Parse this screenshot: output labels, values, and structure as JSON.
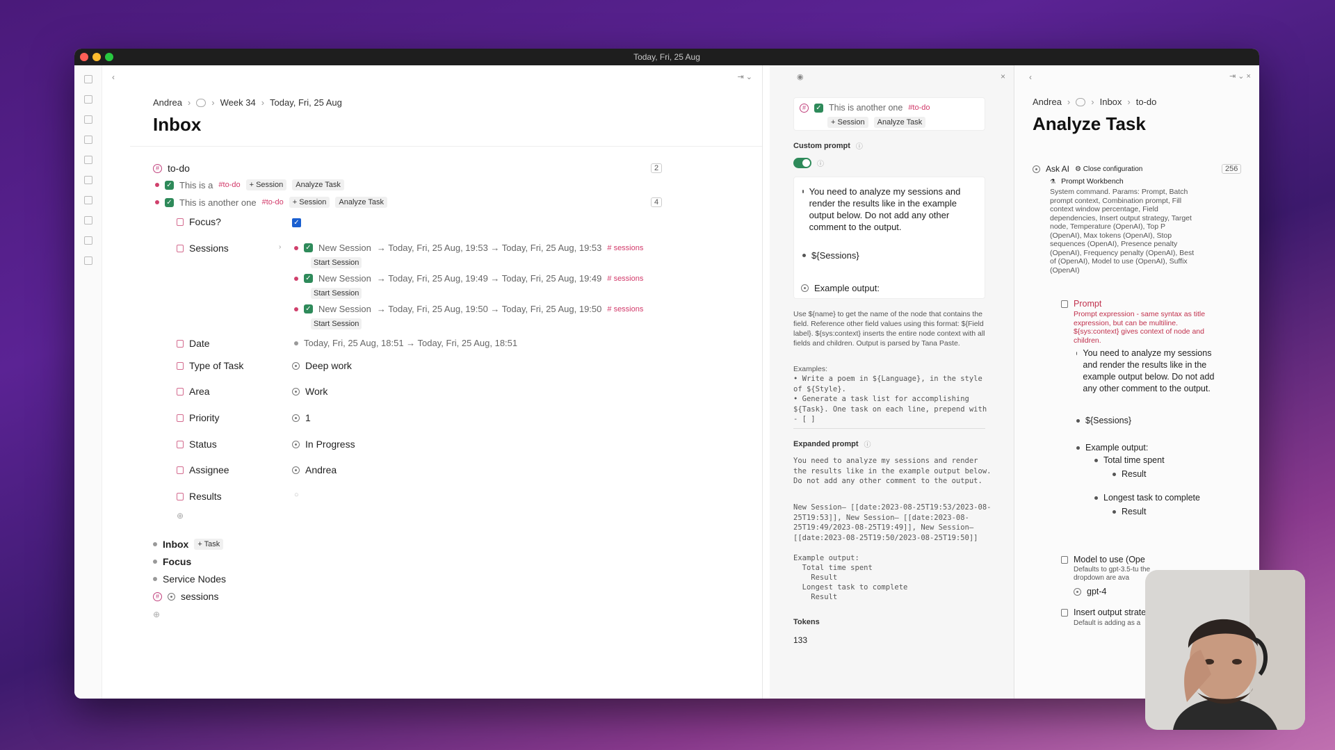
{
  "window": {
    "title": "Today, Fri, 25 Aug"
  },
  "left": {
    "breadcrumb": [
      "Andrea",
      "Week 34",
      "Today, Fri, 25 Aug"
    ],
    "title": "Inbox",
    "todo": {
      "label": "to-do",
      "count": "2"
    },
    "task1": {
      "prefix": "This is a",
      "tag": "#to-do",
      "session_btn": "+ Session",
      "analyze_btn": "Analyze Task"
    },
    "task2": {
      "label": "This is another one",
      "tag": "#to-do",
      "session_btn": "+ Session",
      "analyze_btn": "Analyze Task",
      "count": "4"
    },
    "fields": {
      "focus": "Focus?",
      "sessions": "Sessions",
      "date": "Date",
      "date_value": "Today, Fri, 25 Aug, 18:51 → Today, Fri, 25 Aug, 18:51",
      "type": "Type of Task",
      "type_value": "Deep work",
      "area": "Area",
      "area_value": "Work",
      "priority": "Priority",
      "priority_value": "1",
      "status": "Status",
      "status_value": "In Progress",
      "assignee": "Assignee",
      "assignee_value": "Andrea",
      "results": "Results"
    },
    "sessions": [
      {
        "name": "New Session",
        "range": "→ Today, Fri, 25 Aug, 19:53 → Today, Fri, 25 Aug, 19:53",
        "tag": "# sessions",
        "btn": "Start Session"
      },
      {
        "name": "New Session",
        "range": "→ Today, Fri, 25 Aug, 19:49 → Today, Fri, 25 Aug, 19:49",
        "tag": "# sessions",
        "btn": "Start Session"
      },
      {
        "name": "New Session",
        "range": "→ Today, Fri, 25 Aug, 19:50 → Today, Fri, 25 Aug, 19:50",
        "tag": "# sessions",
        "btn": "Start Session"
      }
    ],
    "bottom": {
      "inbox": "Inbox",
      "task_btn": "+ Task",
      "focus": "Focus",
      "service": "Service Nodes",
      "sessions": "sessions"
    }
  },
  "middle": {
    "node": {
      "label": "This is another one",
      "tag": "#to-do",
      "session_btn": "+ Session",
      "analyze_btn": "Analyze Task"
    },
    "custom_prompt": "Custom prompt",
    "prompt_items": [
      "You need to analyze my sessions and render the results like in the example output below. Do not add any other comment to the output.",
      "${Sessions}",
      "Example output:"
    ],
    "help": "Use ${name} to get the name of the node that contains the field. Reference other field values using this format: ${Field label}. ${sys:context} inserts the entire node context with all fields and children. Output is parsed by Tana Paste.",
    "examples_label": "Examples:",
    "examples": [
      "• Write a poem in ${Language}, in the style of ${Style}.",
      "• Generate a task list for accomplishing ${Task}. One task on each line, prepend with - [ ]"
    ],
    "expanded_label": "Expanded prompt",
    "expanded_1": "You need to analyze my sessions and render the results like in the example output below. Do not add any other comment to the output.",
    "expanded_2": "New Session– [[date:2023-08-25T19:53/2023-08-25T19:53]], New Session– [[date:2023-08-25T19:49/2023-08-25T19:49]], New Session– [[date:2023-08-25T19:50/2023-08-25T19:50]]",
    "expanded_3": [
      "Example output:",
      "  Total time spent",
      "    Result",
      "  Longest task to complete",
      "    Result"
    ],
    "tokens_label": "Tokens",
    "tokens_value": "133"
  },
  "right": {
    "breadcrumb": [
      "Andrea",
      "Inbox",
      "to-do"
    ],
    "title": "Analyze Task",
    "ask_ai": "Ask AI",
    "close_config": "Close configuration",
    "count": "256",
    "workbench": "Prompt Workbench",
    "system_cmd": "System command. Params: Prompt, Batch prompt context, Combination prompt, Fill context window percentage, Field dependencies, Insert output strategy, Target node, Temperature (OpenAI), Top P (OpenAI), Max tokens (OpenAI), Stop sequences (OpenAI), Presence penalty (OpenAI), Frequency penalty (OpenAI), Best of (OpenAI), Model to use (OpenAI), Suffix (OpenAI)",
    "prompt_label": "Prompt",
    "prompt_desc": "Prompt expression - same syntax as title expression, but can be multiline. ${sys:context} gives context of node and children.",
    "prompt_items": [
      "You need to analyze my sessions and render the results like in the example output below. Do not add any other comment to the output.",
      "${Sessions}",
      "Example output:"
    ],
    "sub_items": [
      "Total time spent",
      "Result",
      "Longest task to complete",
      "Result"
    ],
    "model_label": "Model to use (Ope",
    "model_desc": "Defaults to gpt-3.5-tu the dropdown are ava",
    "model_value": "gpt-4",
    "insert_label": "Insert output strate",
    "insert_desc": "Default is adding as a"
  },
  "colors": {
    "accent": "#d23a6a",
    "check": "#2e8a5a",
    "bg_top": "#4a1a7a"
  }
}
